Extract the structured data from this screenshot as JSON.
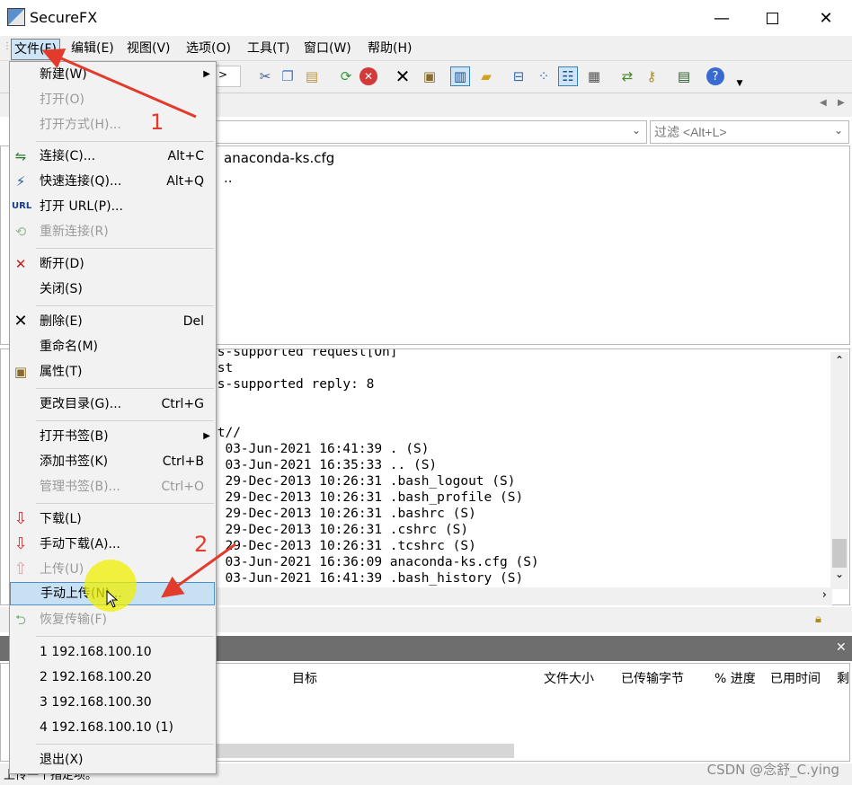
{
  "window": {
    "title": "SecureFX",
    "icon": "securefx-app-icon",
    "minimize": "minimize-icon",
    "maximize": "maximize-icon",
    "close": "close-icon"
  },
  "menubar": {
    "items": [
      "文件(F)",
      "编辑(E)",
      "视图(V)",
      "选项(O)",
      "工具(T)",
      "窗口(W)",
      "帮助(H)"
    ]
  },
  "address": {
    "filter_placeholder": "过滤 <Alt+L>"
  },
  "filelist": {
    "items": [
      "anaconda-ks.cfg",
      ".."
    ]
  },
  "log": {
    "lines": [
      "ts-supported request[On]",
      "est",
      "ts-supported reply: 8",
      ".",
      "ot//",
      "u 03-Jun-2021 16:41:39 . (S)",
      "u 03-Jun-2021 16:35:33 .. (S)",
      "n 29-Dec-2013 10:26:31 .bash_logout (S)",
      "n 29-Dec-2013 10:26:31 .bash_profile (S)",
      "n 29-Dec-2013 10:26:31 .bashrc (S)",
      "n 29-Dec-2013 10:26:31 .cshrc (S)",
      "n 29-Dec-2013 10:26:31 .tcshrc (S)",
      "u 03-Jun-2021 16:36:09 anaconda-ks.cfg (S)",
      "u 03-Jun-2021 16:41:39 .bash_history (S)"
    ]
  },
  "transfer": {
    "columns": [
      "目标",
      "文件大小",
      "已传输字节",
      "% 进度",
      "已用时间",
      "剩"
    ]
  },
  "file_menu": {
    "new": "新建(W)",
    "open": "打开(O)",
    "open_with": "打开方式(H)...",
    "connect": "连接(C)...",
    "connect_sc": "Alt+C",
    "quick_connect": "快速连接(Q)...",
    "quick_connect_sc": "Alt+Q",
    "open_url": "打开 URL(P)...",
    "reconnect": "重新连接(R)",
    "disconnect": "断开(D)",
    "close": "关闭(S)",
    "delete": "删除(E)",
    "delete_sc": "Del",
    "rename": "重命名(M)",
    "properties": "属性(T)",
    "chdir": "更改目录(G)...",
    "chdir_sc": "Ctrl+G",
    "open_bookmark": "打开书签(B)",
    "add_bookmark": "添加书签(K)",
    "add_bookmark_sc": "Ctrl+B",
    "manage_bookmarks": "管理书签(B)...",
    "manage_bookmarks_sc": "Ctrl+O",
    "download": "下载(L)",
    "manual_download": "手动下载(A)...",
    "upload": "上传(U)",
    "manual_upload": "手动上传(N)...",
    "resume": "恢复传输(F)",
    "recent1": "1 192.168.100.10",
    "recent2": "2 192.168.100.20",
    "recent3": "3 192.168.100.30",
    "recent4": "4 192.168.100.10 (1)",
    "exit": "退出(X)"
  },
  "annotations": {
    "step1": "1",
    "step2": "2",
    "arrow_color": "#e23b2b"
  },
  "status": {
    "bottom": "上传一个指定项。"
  },
  "watermark": "CSDN @念舒_C.ying"
}
